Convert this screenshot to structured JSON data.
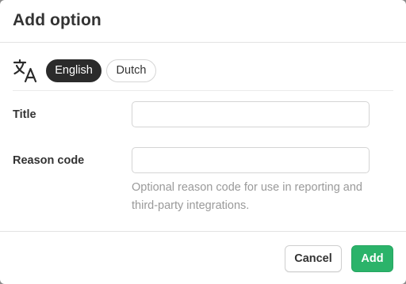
{
  "dialog": {
    "title": "Add option"
  },
  "languages": {
    "icon": "translate-icon",
    "items": [
      {
        "label": "English",
        "selected": true
      },
      {
        "label": "Dutch",
        "selected": false
      }
    ]
  },
  "fields": {
    "title": {
      "label": "Title",
      "value": "",
      "placeholder": ""
    },
    "reason_code": {
      "label": "Reason code",
      "value": "",
      "placeholder": "",
      "help": "Optional reason code for use in reporting and third-party integrations."
    }
  },
  "footer": {
    "cancel_label": "Cancel",
    "add_label": "Add"
  },
  "colors": {
    "primary": "#2bb36a",
    "selected_pill": "#2b2b2b",
    "help_text": "#9a9a9a"
  }
}
